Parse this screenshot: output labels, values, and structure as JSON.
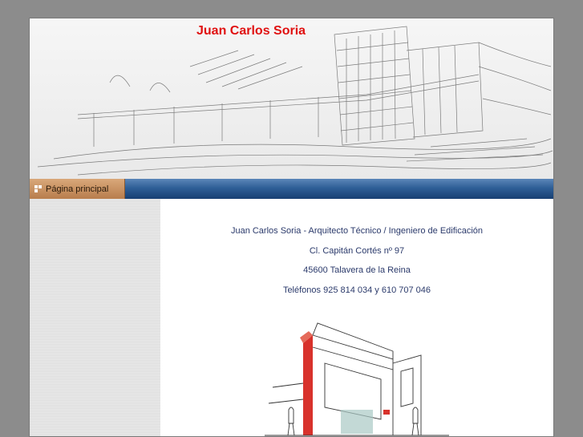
{
  "header": {
    "title": "Juan Carlos Soria"
  },
  "nav": {
    "items": [
      {
        "label": "Página principal",
        "icon": "page-icon",
        "active": true
      }
    ],
    "bar_color": "#2f5f97",
    "active_color": "#c48a58"
  },
  "main": {
    "lines": [
      "Juan Carlos Soria - Arquitecto Técnico / Ingeniero de Edificación",
      "Cl. Capitán Cortés nº 97",
      "45600 Talavera de la Reina",
      "Teléfonos 925 814 034  y  610 707 046"
    ]
  },
  "colors": {
    "title": "#e01010",
    "text": "#2b3a6b",
    "background": "#8c8c8c"
  }
}
